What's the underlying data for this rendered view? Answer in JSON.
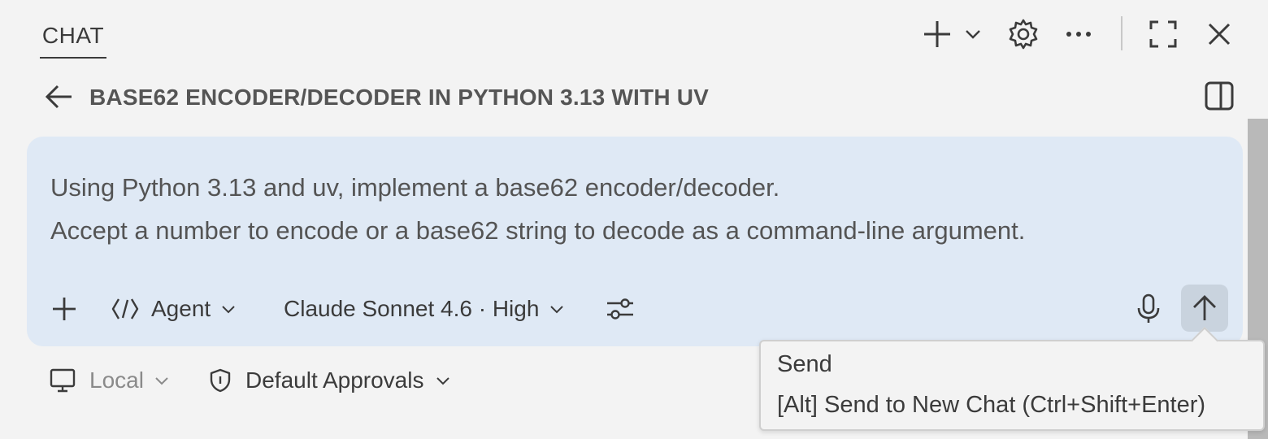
{
  "header": {
    "tab_label": "CHAT",
    "icons": {
      "new": "plus-icon",
      "new_dropdown": "chevron-down-icon",
      "settings": "gear-icon",
      "more": "ellipsis-icon",
      "maximize": "maximize-icon",
      "close": "close-icon"
    }
  },
  "title_bar": {
    "title": "BASE62 ENCODER/DECODER IN PYTHON 3.13 WITH UV",
    "back_icon": "arrow-left-icon",
    "panel_icon": "split-panel-icon"
  },
  "input": {
    "prompt_lines": [
      "Using Python 3.13 and uv, implement a base62 encoder/decoder.",
      "Accept a number to encode or a base62 string to decode as a command-line argument."
    ],
    "mode_label": "Agent",
    "model_label": "Claude Sonnet 4.6 · High",
    "icons": {
      "attach": "plus-icon",
      "mode": "agent-icon",
      "tools": "sliders-icon",
      "mic": "microphone-icon",
      "send": "arrow-up-icon"
    }
  },
  "bottom": {
    "location_label": "Local",
    "approvals_label": "Default Approvals",
    "icons": {
      "location": "monitor-icon",
      "approvals": "shield-icon"
    }
  },
  "tooltip": {
    "line1": "Send",
    "line2": "[Alt] Send to New Chat (Ctrl+Shift+Enter)"
  },
  "colors": {
    "background": "#f3f3f3",
    "input_background": "#dfe9f5",
    "send_button": "#c9d3de",
    "scrollbar": "#b9b9b9",
    "text": "#3b3b3b",
    "muted_text": "#8a8a8a"
  }
}
